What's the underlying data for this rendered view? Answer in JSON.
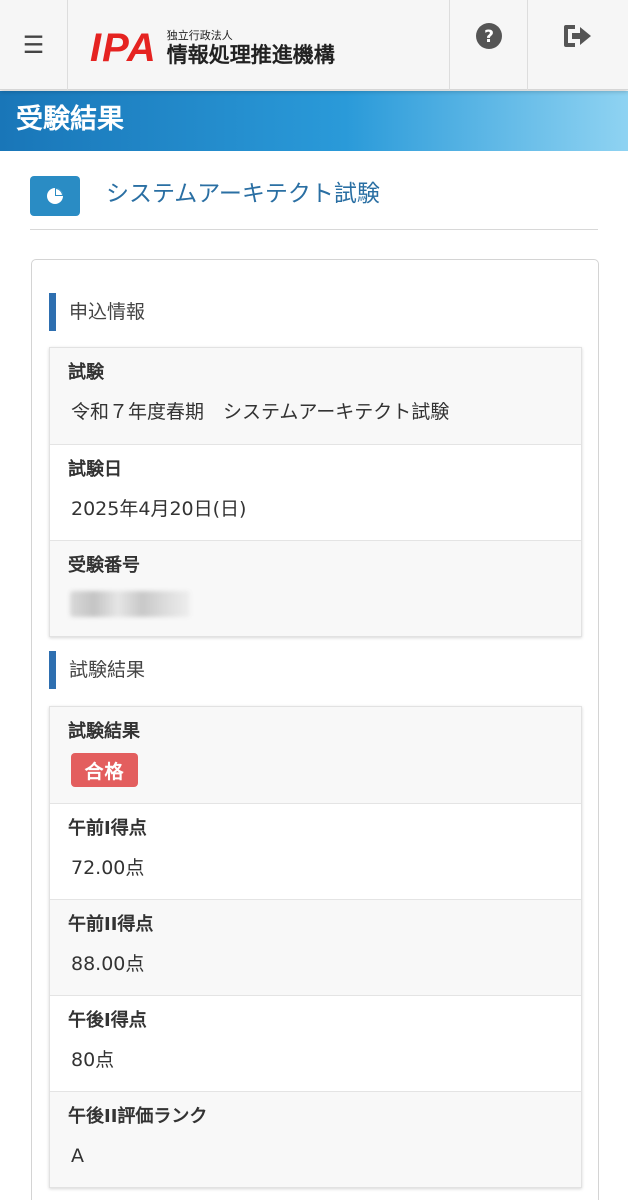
{
  "header": {
    "menu_icon": "hamburger-menu-icon",
    "logo_mark": "IPA",
    "logo_sub": "独立行政法人",
    "logo_main": "情報処理推進機構",
    "help_icon": "question-circle-icon",
    "logout_icon": "sign-out-icon"
  },
  "page": {
    "title": "受験結果",
    "exam_icon": "pie-chart-icon",
    "exam_name": "システムアーキテクト試験"
  },
  "sections": {
    "application": {
      "heading": "申込情報",
      "items": [
        {
          "label": "試験",
          "value": "令和７年度春期　システムアーキテクト試験"
        },
        {
          "label": "試験日",
          "value": "2025年4月20日(日)"
        },
        {
          "label": "受験番号",
          "value": ""
        }
      ]
    },
    "result": {
      "heading": "試験結果",
      "items": [
        {
          "label": "試験結果",
          "value": "合格"
        },
        {
          "label": "午前I得点",
          "value": "72.00点"
        },
        {
          "label": "午前II得点",
          "value": "88.00点"
        },
        {
          "label": "午後I得点",
          "value": "80点"
        },
        {
          "label": "午後II評価ランク",
          "value": "A"
        }
      ]
    }
  },
  "colors": {
    "brand_red": "#e52321",
    "banner_blue": "#1976b8",
    "accent_blue": "#2e6fb0",
    "pass_badge": "#e35e5e"
  }
}
